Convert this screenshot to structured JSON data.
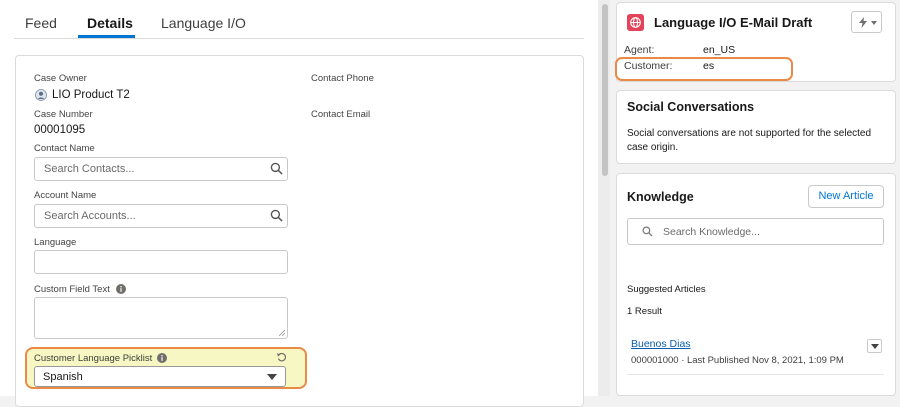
{
  "tabs": [
    {
      "label": "Feed"
    },
    {
      "label": "Details",
      "active": true
    },
    {
      "label": "Language I/O"
    }
  ],
  "details": {
    "case_owner": {
      "label": "Case Owner",
      "value": "LIO Product T2"
    },
    "contact_phone": {
      "label": "Contact Phone"
    },
    "case_number": {
      "label": "Case Number",
      "value": "00001095"
    },
    "contact_email": {
      "label": "Contact Email"
    },
    "contact_name": {
      "label": "Contact Name",
      "placeholder": "Search Contacts..."
    },
    "account_name": {
      "label": "Account Name",
      "placeholder": "Search Accounts..."
    },
    "language": {
      "label": "Language",
      "value": ""
    },
    "custom_field_text": {
      "label": "Custom Field Text",
      "value": ""
    },
    "customer_language_picklist": {
      "label": "Customer Language Picklist",
      "value": "Spanish"
    }
  },
  "lio_card": {
    "title": "Language I/O E-Mail Draft",
    "agent_label": "Agent:",
    "agent_value": "en_US",
    "customer_label": "Customer:",
    "customer_value": "es"
  },
  "social_card": {
    "title": "Social Conversations",
    "text_line1": "Social conversations are not supported for the selected",
    "text_line2": "case origin."
  },
  "knowledge_card": {
    "title": "Knowledge",
    "new_article_label": "New Article",
    "search_placeholder": "Search Knowledge...",
    "suggested_label": "Suggested Articles",
    "result_count": "1 Result",
    "article_title": "Buenos Dias",
    "article_meta": "000001000  ·  Last Published  Nov 8, 2021, 1:09 PM"
  },
  "colors": {
    "brand_blue": "#0176d3",
    "highlight_orange": "#ea8a47",
    "highlight_yellow": "#f7f7c4",
    "globe_red": "#e3445b"
  }
}
